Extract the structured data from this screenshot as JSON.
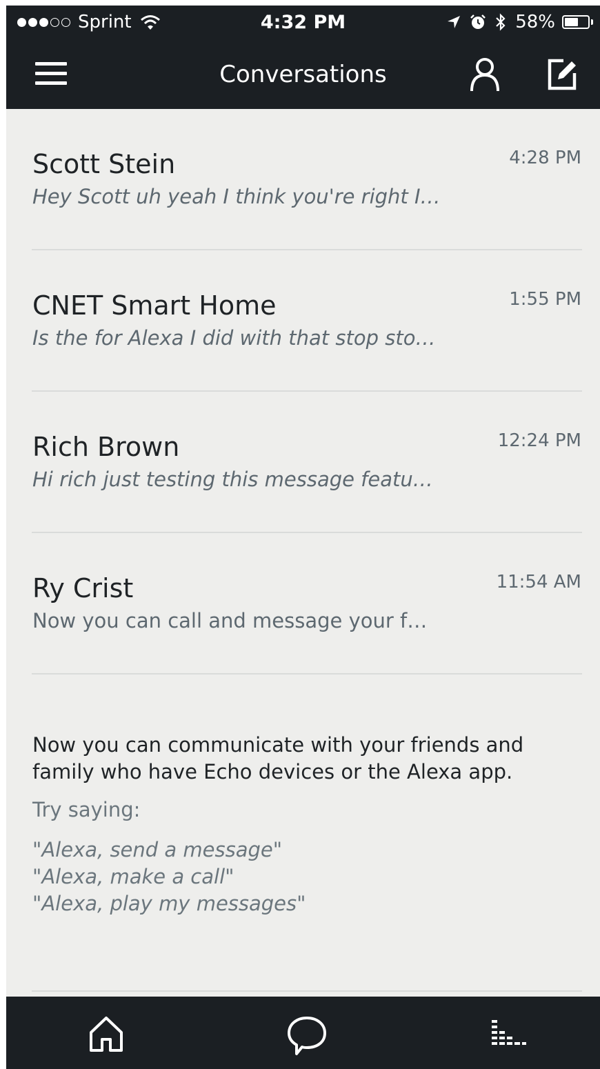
{
  "status_bar": {
    "carrier": "Sprint",
    "time": "4:32 PM",
    "battery": "58%",
    "battery_level": 0.58,
    "signal_bars_filled": 3,
    "signal_bars_total": 5,
    "icons": [
      "wifi-icon",
      "location-arrow-icon",
      "alarm-icon",
      "bluetooth-icon",
      "battery-icon"
    ]
  },
  "header": {
    "title": "Conversations",
    "left_icon": "menu-icon",
    "right_icons": [
      "profile-icon",
      "compose-icon"
    ]
  },
  "conversations": [
    {
      "name": "Scott Stein",
      "preview": "Hey Scott uh yeah I think you're right I…",
      "time": "4:28 PM",
      "italic": true
    },
    {
      "name": "CNET Smart Home",
      "preview": "Is the for Alexa I did with that stop sto…",
      "time": "1:55 PM",
      "italic": true
    },
    {
      "name": "Rich Brown",
      "preview": "Hi rich just testing this message featu…",
      "time": "12:24 PM",
      "italic": true
    },
    {
      "name": "Ry Crist",
      "preview": "Now you can call and message your f…",
      "time": "11:54 AM",
      "italic": false
    }
  ],
  "info": {
    "line1": "Now you can communicate with your friends and",
    "line2": "family who have Echo devices or the Alexa app.",
    "try_label": "Try saying:",
    "examples": [
      "\"Alexa, send a message\"",
      "\"Alexa, make a call\"",
      "\"Alexa, play my messages\""
    ]
  },
  "tab_bar": {
    "tabs": [
      "home-icon",
      "conversations-icon",
      "activity-icon"
    ]
  },
  "colors": {
    "bar_background": "#1b1f23",
    "list_background": "#eeeeec",
    "primary_text": "#1f2326",
    "secondary_text": "#5d6870"
  }
}
